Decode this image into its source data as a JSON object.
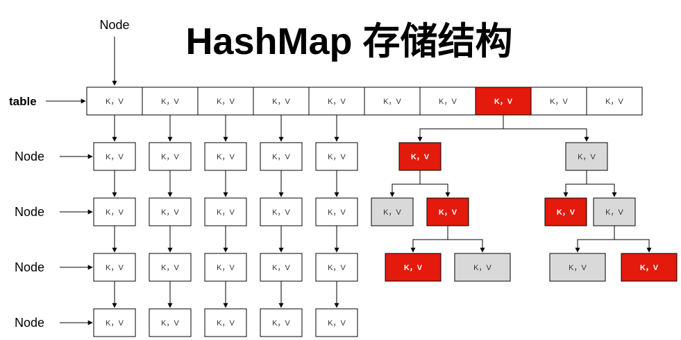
{
  "title": "HashMap 存储结构",
  "node_label_top": "Node",
  "table_label": "table",
  "row_labels": [
    "Node",
    "Node",
    "Node",
    "Node"
  ],
  "kv": "K，V",
  "table_slots": 10,
  "red_slot_index": 7,
  "chains": {
    "columns": 5,
    "length": 4
  },
  "colors": {
    "red_node": "#e31a0c",
    "black_node": "#d9d9d9",
    "plain_node": "#ffffff",
    "border": "#000000",
    "edge": "#000000"
  },
  "tree_left": [
    {
      "id": "L1",
      "color": "red",
      "parent": null
    },
    {
      "id": "L2a",
      "color": "black",
      "parent": "L1"
    },
    {
      "id": "L2b",
      "color": "red",
      "parent": "L1"
    },
    {
      "id": "L3a",
      "color": "red",
      "parent": "L2b"
    },
    {
      "id": "L3b",
      "color": "black",
      "parent": "L2b"
    }
  ],
  "tree_right": [
    {
      "id": "R1",
      "color": "black",
      "parent": null
    },
    {
      "id": "R2a",
      "color": "red",
      "parent": "R1"
    },
    {
      "id": "R2b",
      "color": "black",
      "parent": "R1"
    },
    {
      "id": "R3a",
      "color": "black",
      "parent": "R2b"
    },
    {
      "id": "R3b",
      "color": "red",
      "parent": "R2b"
    }
  ]
}
